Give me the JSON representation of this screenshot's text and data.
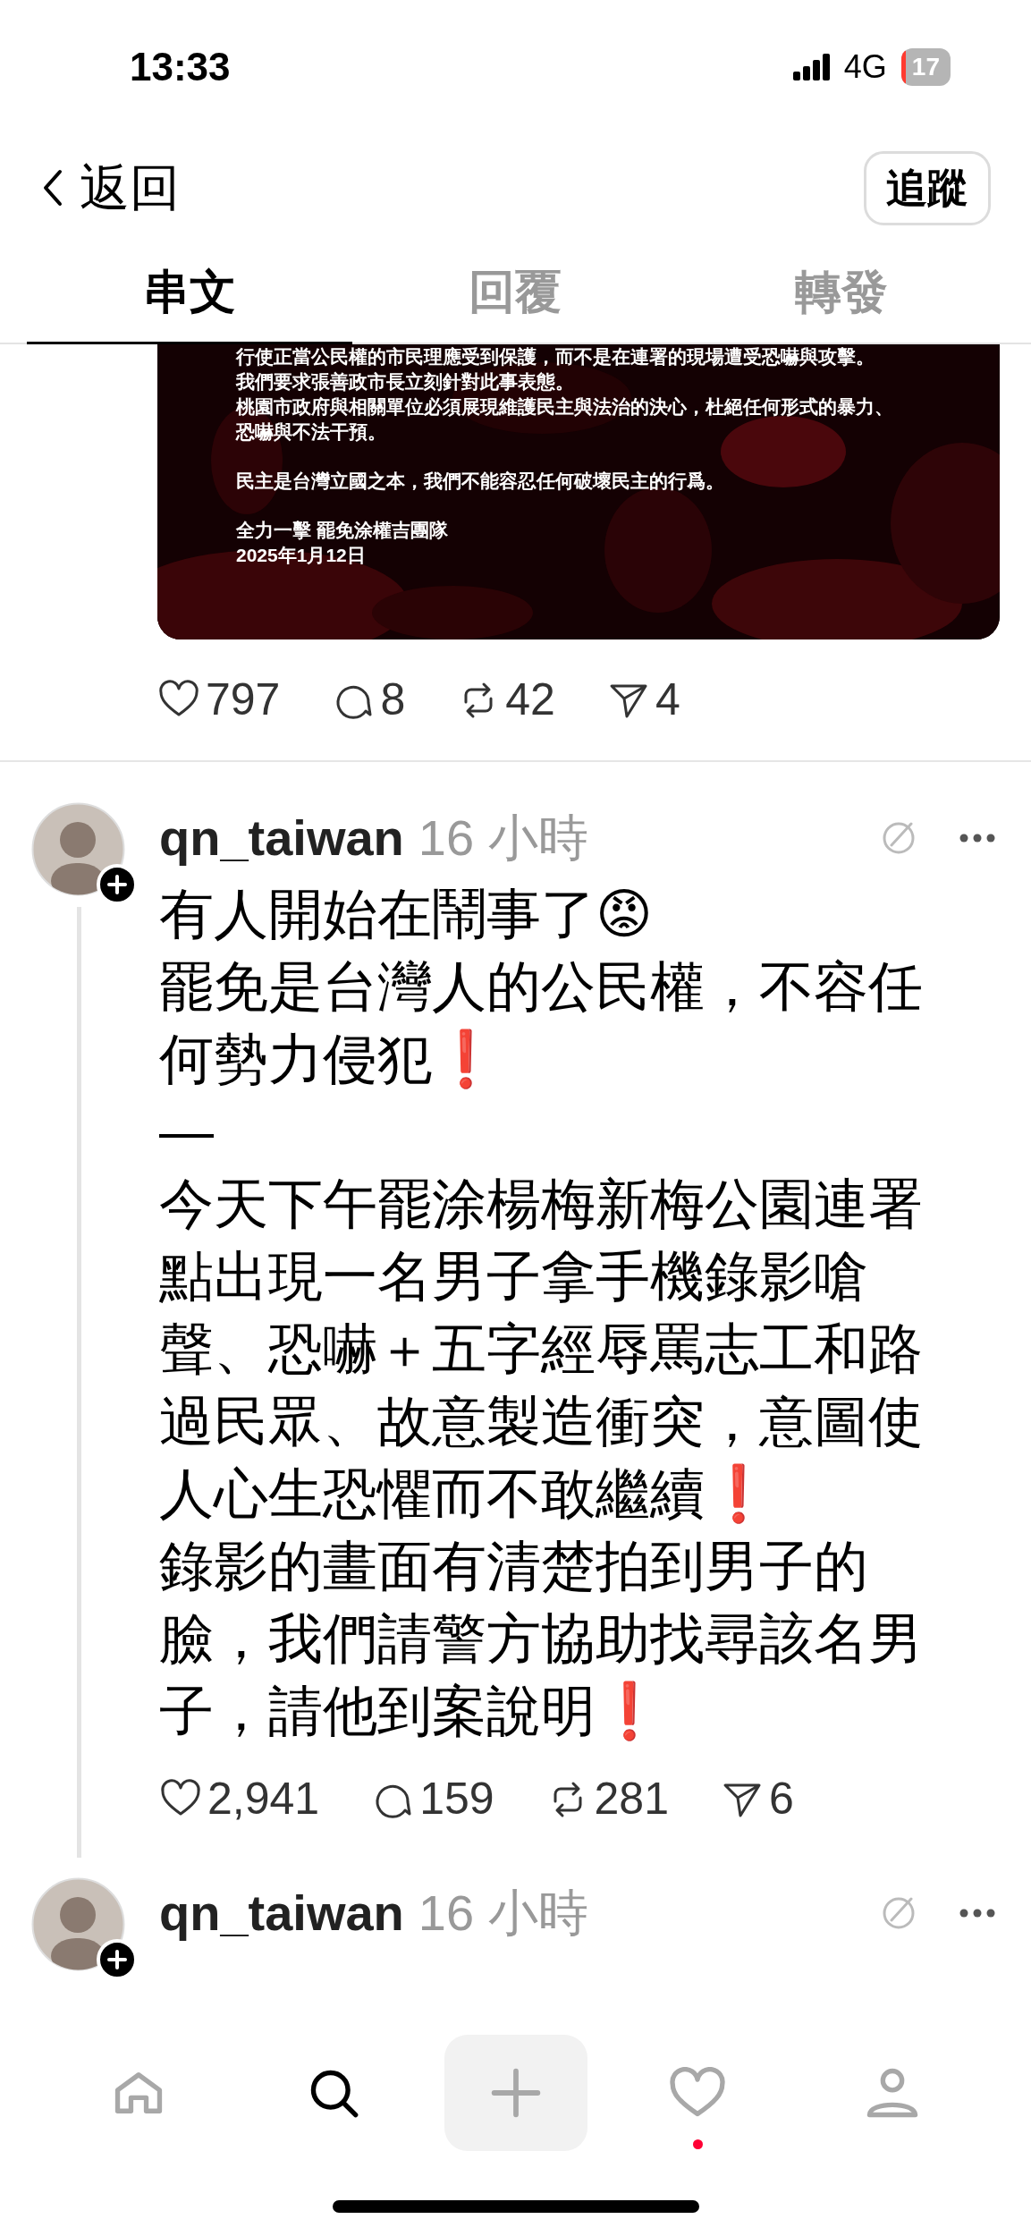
{
  "status_bar": {
    "time": "13:33",
    "network": "4G",
    "battery": "17"
  },
  "header": {
    "back_label": "返回",
    "follow_button": "追蹤"
  },
  "tabs": [
    {
      "label": "串文",
      "selected": true
    },
    {
      "label": "回覆",
      "selected": false
    },
    {
      "label": "轉發",
      "selected": false
    }
  ],
  "image_post": {
    "image_paragraphs": [
      [
        "行使正當公民權的市民理應受到保護，而不是在連署的現場遭受恐嚇與攻擊。",
        "我們要求張善政市長立刻針對此事表態。",
        "桃園市政府與相關單位必須展現維護民主與法治的決心，杜絕任何形式的暴力、",
        "恐嚇與不法干預。"
      ],
      [
        "民主是台灣立國之本，我們不能容忍任何破壞民主的行爲。"
      ],
      [
        "全力一擊 罷免涂權吉團隊",
        "2025年1月12日"
      ]
    ],
    "stats": {
      "likes": "797",
      "replies": "8",
      "reposts": "42",
      "shares": "4"
    }
  },
  "posts": [
    {
      "username": "qn_taiwan",
      "time": "16 小時",
      "body": "有人開始在鬧事了😡\n罷免是台灣人的公民權，不容任何勢力侵犯❗️\n—\n今天下午罷涂楊梅新梅公園連署點出現一名男子拿手機錄影嗆聲、恐嚇＋五字經辱罵志工和路過民眾、故意製造衝突，意圖使人心生恐懼而不敢繼續❗️\n錄影的畫面有清楚拍到男子的臉，我們請警方協助找尋該名男子，請他到案說明❗️",
      "stats": {
        "likes": "2,941",
        "replies": "159",
        "reposts": "281",
        "shares": "6"
      }
    },
    {
      "username": "qn_taiwan",
      "time": "16 小時"
    }
  ],
  "nav": [
    {
      "kind": "home",
      "selected": false
    },
    {
      "kind": "search",
      "selected": true
    },
    {
      "kind": "create",
      "selected": false
    },
    {
      "kind": "activity",
      "selected": false,
      "unread": true
    },
    {
      "kind": "profile",
      "selected": false
    }
  ]
}
